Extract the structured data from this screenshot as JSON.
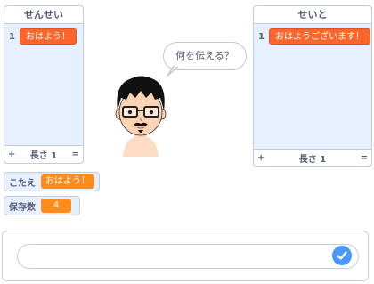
{
  "list_sensei": {
    "title": "せんせい",
    "items": [
      {
        "index": "1",
        "value": "おはよう！"
      }
    ],
    "add": "+",
    "length_label": "長さ 1",
    "resize": "="
  },
  "list_seito": {
    "title": "せいと",
    "items": [
      {
        "index": "1",
        "value": "おはようございます！"
      }
    ],
    "add": "+",
    "length_label": "長さ 1",
    "resize": "="
  },
  "speech_bubble": {
    "text": "何を伝える？"
  },
  "variables": {
    "answer": {
      "label": "こたえ",
      "value": "おはよう！"
    },
    "saved_count": {
      "label": "保存数",
      "value": "4"
    }
  },
  "ask": {
    "value": "",
    "placeholder": ""
  },
  "icons": {
    "submit": "check-icon",
    "sprite": "avatar-face"
  },
  "colors": {
    "list_item": "#fc662c",
    "variable_value": "#ff8c1a",
    "monitor_bg": "#e6f0ff",
    "submit": "#4c97ff",
    "text": "#575e75"
  }
}
